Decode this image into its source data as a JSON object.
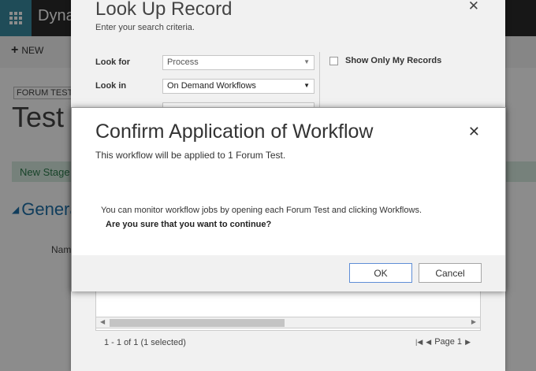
{
  "background": {
    "app_title": "Dyna",
    "new_label": "NEW",
    "entity_label": "FORUM TEST",
    "record_title": "Test -",
    "stage_label": "New Stage",
    "section_title": "Genera",
    "field_label": "Nam"
  },
  "lookup": {
    "title": "Look Up Record",
    "subtitle": "Enter your search criteria.",
    "look_for_label": "Look for",
    "look_for_value": "Process",
    "look_in_label": "Look in",
    "look_in_value": "On Demand Workflows",
    "show_only_mine": "Show Only My Records",
    "record_count": "1 - 1 of 1 (1 selected)",
    "page_label": "Page 1"
  },
  "confirm": {
    "title": "Confirm Application of Workflow",
    "subtitle": "This workflow will be applied to 1 Forum Test.",
    "message": "You can monitor workflow jobs by opening each Forum Test and clicking Workflows.",
    "question": "Are you sure that you want to continue?",
    "ok_label": "OK",
    "cancel_label": "Cancel"
  },
  "colors": {
    "waffle": "#3a8aa0",
    "topbar": "#2b2b2b",
    "stage_bar": "#d8ece0",
    "section_title": "#1e6fa8",
    "ok_border": "#5f8ed6"
  }
}
